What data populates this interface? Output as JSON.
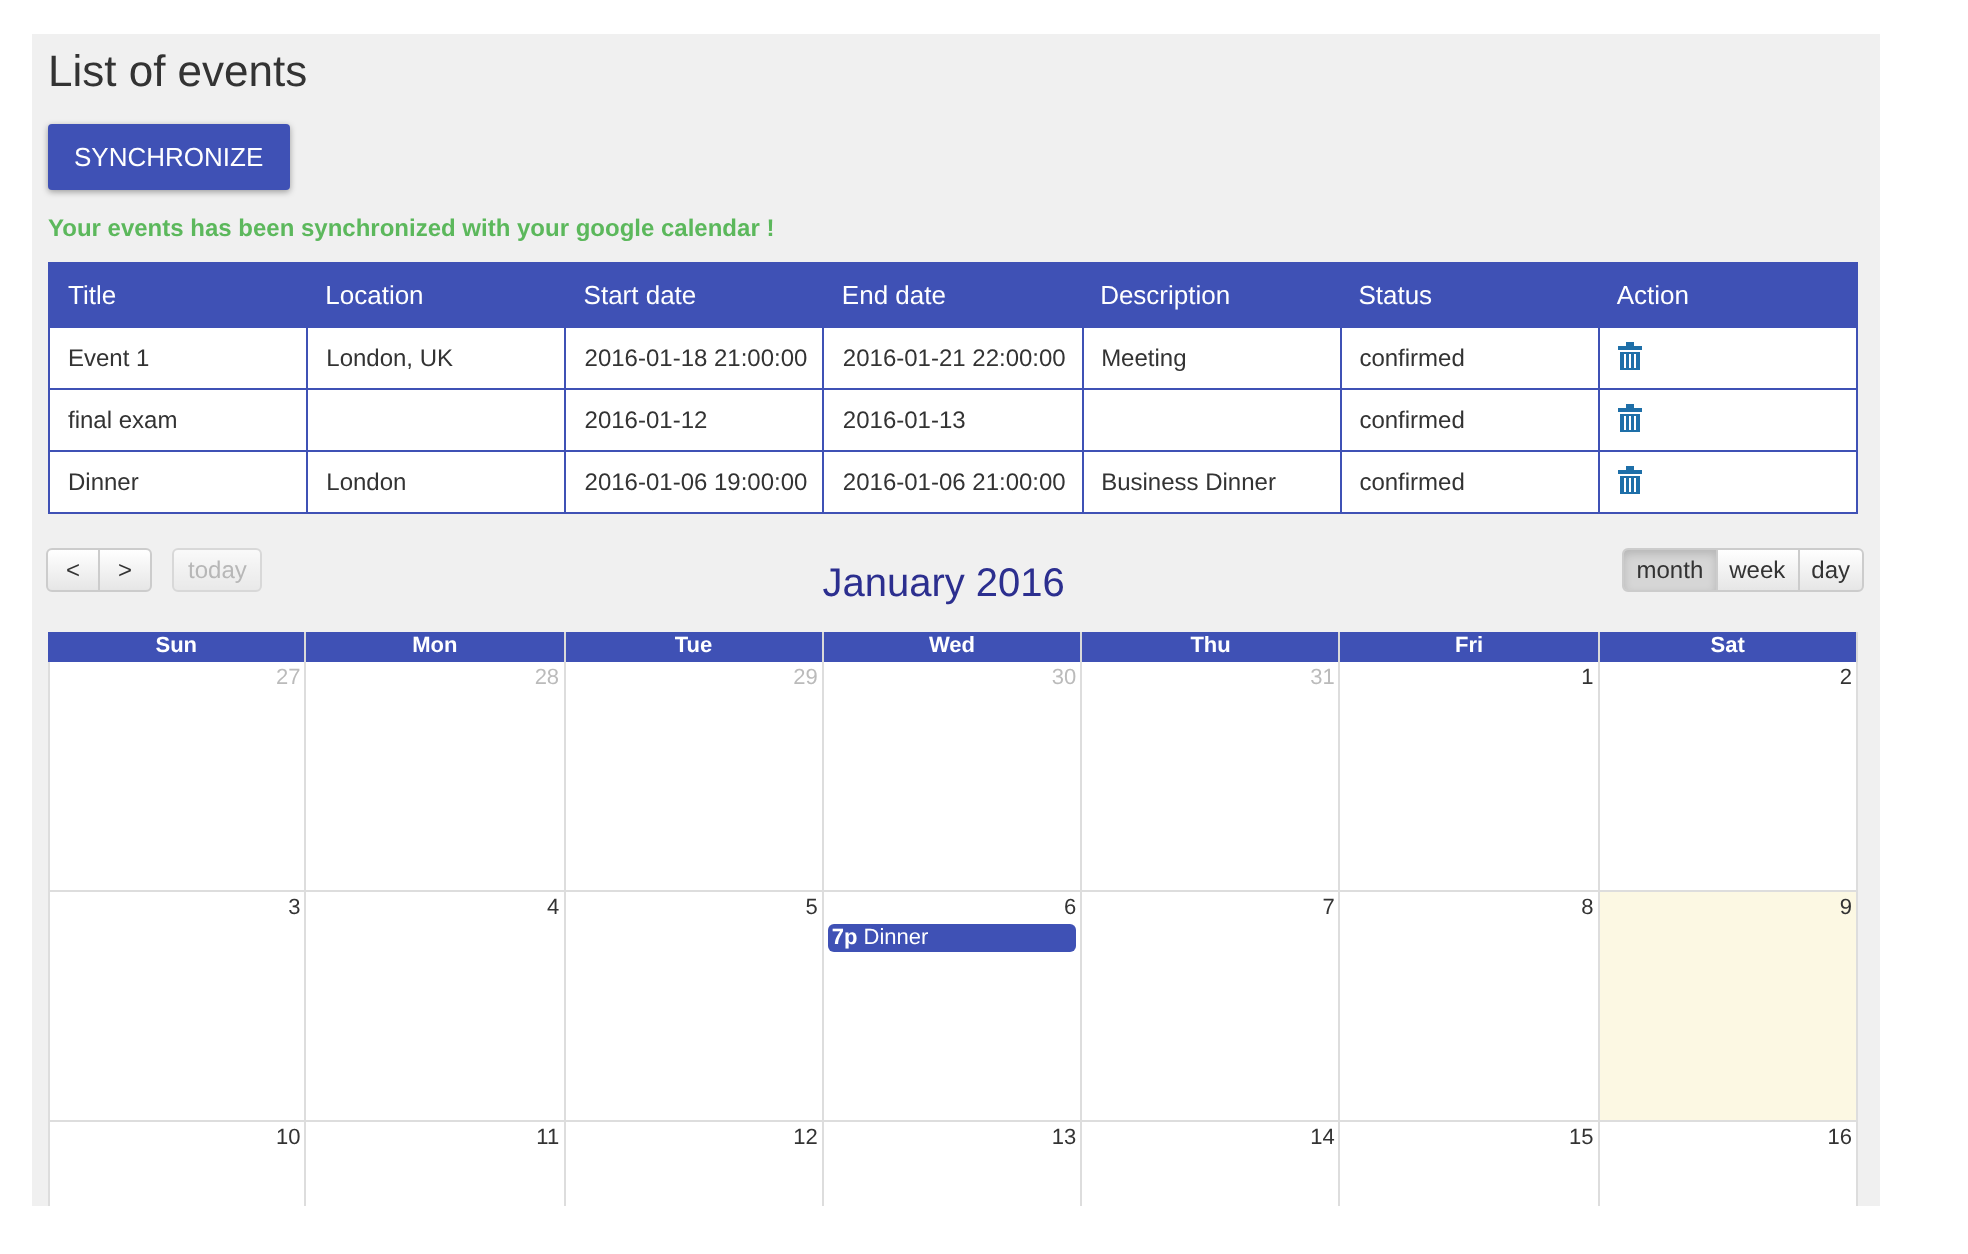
{
  "title": "List of events",
  "sync_button": "SYNCHRONIZE",
  "message": "Your events has been synchronized with your google calendar !",
  "table": {
    "columns": [
      "Title",
      "Location",
      "Start date",
      "End date",
      "Description",
      "Status",
      "Action"
    ],
    "rows": [
      {
        "title": "Event 1",
        "location": "London, UK",
        "start": "2016-01-18 21:00:00",
        "end": "2016-01-21 22:00:00",
        "description": "Meeting",
        "status": "confirmed"
      },
      {
        "title": "final exam",
        "start": "2016-01-12",
        "end": "2016-01-13",
        "status": "confirmed"
      },
      {
        "title": "Dinner",
        "location": "London",
        "start": "2016-01-06 19:00:00",
        "end": "2016-01-06 21:00:00",
        "description": "Business Dinner",
        "status": "confirmed"
      }
    ]
  },
  "calendar": {
    "nav": [
      {
        "label": "<"
      },
      {
        "label": ">"
      }
    ],
    "today_button": {
      "label": "today",
      "disabled": true
    },
    "title": "January 2016",
    "views": [
      {
        "label": "month",
        "selected": true
      },
      {
        "label": "week",
        "selected": false
      },
      {
        "label": "day",
        "selected": false
      }
    ],
    "weekdays": [
      "Sun",
      "Mon",
      "Tue",
      "Wed",
      "Thu",
      "Fri",
      "Sat"
    ],
    "weeks": [
      [
        {
          "day": "27",
          "other_month": true,
          "today": false
        },
        {
          "day": "28",
          "other_month": true,
          "today": false
        },
        {
          "day": "29",
          "other_month": true,
          "today": false
        },
        {
          "day": "30",
          "other_month": true,
          "today": false
        },
        {
          "day": "31",
          "other_month": true,
          "today": false
        },
        {
          "day": "1",
          "other_month": false,
          "today": false
        },
        {
          "day": "2",
          "other_month": false,
          "today": false
        }
      ],
      [
        {
          "day": "3",
          "other_month": false,
          "today": false
        },
        {
          "day": "4",
          "other_month": false,
          "today": false
        },
        {
          "day": "5",
          "other_month": false,
          "today": false
        },
        {
          "day": "6",
          "other_month": false,
          "today": false,
          "events": [
            {
              "time": "7p",
              "title": "Dinner"
            }
          ]
        },
        {
          "day": "7",
          "other_month": false,
          "today": false
        },
        {
          "day": "8",
          "other_month": false,
          "today": false
        },
        {
          "day": "9",
          "other_month": false,
          "today": true
        }
      ],
      [
        {
          "day": "10",
          "other_month": false,
          "today": false
        },
        {
          "day": "11",
          "other_month": false,
          "today": false
        },
        {
          "day": "12",
          "other_month": false,
          "today": false
        },
        {
          "day": "13",
          "other_month": false,
          "today": false
        },
        {
          "day": "14",
          "other_month": false,
          "today": false
        },
        {
          "day": "15",
          "other_month": false,
          "today": false
        },
        {
          "day": "16",
          "other_month": false,
          "today": false
        }
      ]
    ]
  }
}
